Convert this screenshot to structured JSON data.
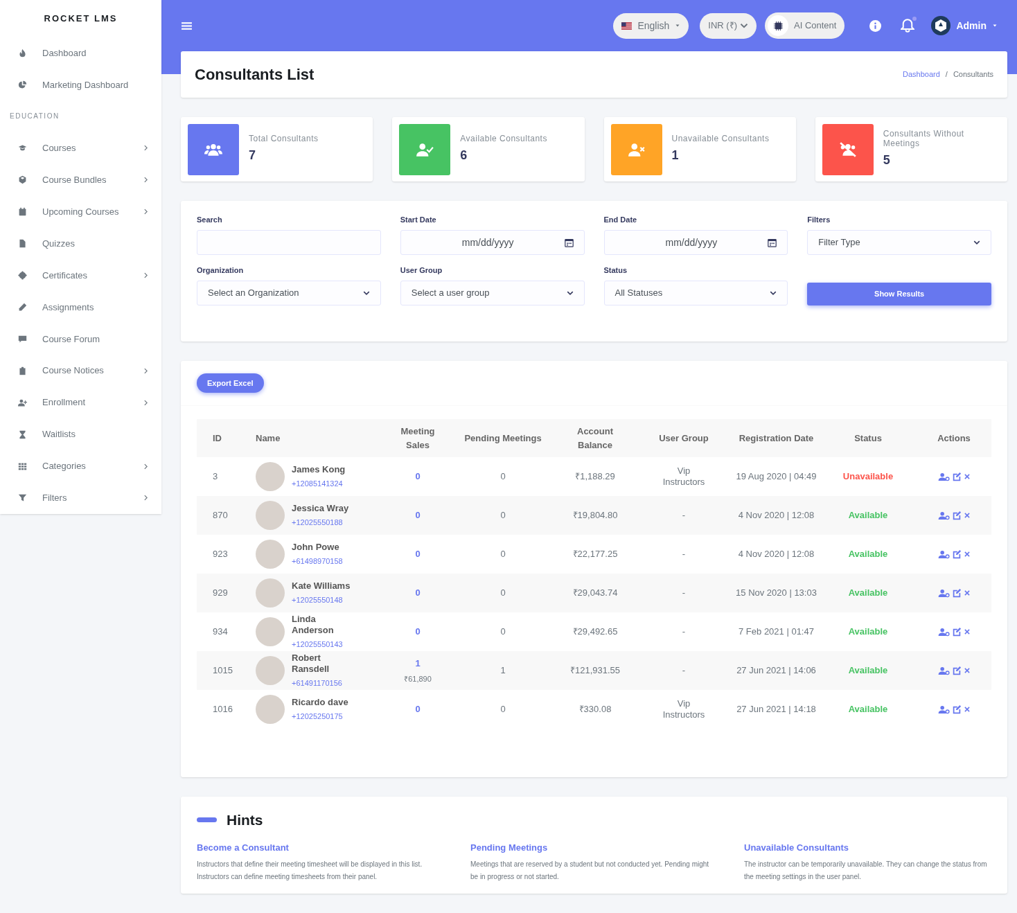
{
  "sidebar": {
    "brand": "ROCKET LMS",
    "items": [
      {
        "kind": "item",
        "label": "Dashboard",
        "has_submenu": false
      },
      {
        "kind": "item",
        "label": "Marketing Dashboard",
        "has_submenu": false
      },
      {
        "kind": "section",
        "label": "EDUCATION"
      },
      {
        "kind": "item",
        "label": "Courses",
        "has_submenu": true
      },
      {
        "kind": "item",
        "label": "Course Bundles",
        "has_submenu": true
      },
      {
        "kind": "item",
        "label": "Upcoming Courses",
        "has_submenu": true
      },
      {
        "kind": "item",
        "label": "Quizzes",
        "has_submenu": false
      },
      {
        "kind": "item",
        "label": "Certificates",
        "has_submenu": true
      },
      {
        "kind": "item",
        "label": "Assignments",
        "has_submenu": false
      },
      {
        "kind": "item",
        "label": "Course Forum",
        "has_submenu": false
      },
      {
        "kind": "item",
        "label": "Course Notices",
        "has_submenu": true
      },
      {
        "kind": "item",
        "label": "Enrollment",
        "has_submenu": true
      },
      {
        "kind": "item",
        "label": "Waitlists",
        "has_submenu": false
      },
      {
        "kind": "item",
        "label": "Categories",
        "has_submenu": true
      },
      {
        "kind": "item",
        "label": "Filters",
        "has_submenu": true
      }
    ]
  },
  "topbar": {
    "language": "English",
    "currency": "INR (₹)",
    "ai_button": "AI Content",
    "notification_dot": true,
    "user": "Admin"
  },
  "page": {
    "title": "Consultants List",
    "breadcrumbs": [
      {
        "label": "Dashboard",
        "link": true
      },
      {
        "label": "Consultants",
        "link": false
      }
    ],
    "breadcrumb_separator": "/"
  },
  "stats": [
    {
      "label": "Total Consultants",
      "value": "7",
      "color": "#6777ef"
    },
    {
      "label": "Available Consultants",
      "value": "6",
      "color": "#47c363"
    },
    {
      "label": "Unavailable Consultants",
      "value": "1",
      "color": "#ffa426"
    },
    {
      "label": "Consultants Without Meetings",
      "value": "5",
      "color": "#fc544b"
    }
  ],
  "filters": [
    {
      "kind": "text",
      "label": "Search"
    },
    {
      "kind": "date",
      "label": "Start Date",
      "placeholder": "mm/dd/yyyy"
    },
    {
      "kind": "date",
      "label": "End Date",
      "placeholder": "mm/dd/yyyy"
    },
    {
      "kind": "select",
      "label": "Filters",
      "value": "Filter Type"
    },
    {
      "kind": "select",
      "label": "Organization",
      "value": "Select an Organization"
    },
    {
      "kind": "select",
      "label": "User Group",
      "value": "Select a user group"
    },
    {
      "kind": "select",
      "label": "Status",
      "value": "All Statuses"
    },
    {
      "kind": "button",
      "label": "Show Results"
    }
  ],
  "export_button": "Export Excel",
  "table": {
    "columns": [
      "ID",
      "Name",
      "Meeting Sales",
      "Pending Meetings",
      "Account Balance",
      "User Group",
      "Registration Date",
      "Status",
      "Actions"
    ],
    "rows": [
      {
        "id": "3",
        "name": "James Kong",
        "phone": "+12085141324",
        "sales": "0",
        "pending": "0",
        "balance": "₹1,188.29",
        "group": "Vip Instructors",
        "date": "19 Aug 2020 | 04:49",
        "status": "Unavailable",
        "available": false
      },
      {
        "id": "870",
        "name": "Jessica Wray",
        "phone": "+12025550188",
        "sales": "0",
        "pending": "0",
        "balance": "₹19,804.80",
        "group": "-",
        "date": "4 Nov 2020 | 12:08",
        "status": "Available",
        "available": true
      },
      {
        "id": "923",
        "name": "John Powe",
        "phone": "+61498970158",
        "sales": "0",
        "pending": "0",
        "balance": "₹22,177.25",
        "group": "-",
        "date": "4 Nov 2020 | 12:08",
        "status": "Available",
        "available": true
      },
      {
        "id": "929",
        "name": "Kate Williams",
        "phone": "+12025550148",
        "sales": "0",
        "pending": "0",
        "balance": "₹29,043.74",
        "group": "-",
        "date": "15 Nov 2020 | 13:03",
        "status": "Available",
        "available": true
      },
      {
        "id": "934",
        "name": "Linda Anderson",
        "phone": "+12025550143",
        "sales": "0",
        "pending": "0",
        "balance": "₹29,492.65",
        "group": "-",
        "date": "7 Feb 2021 | 01:47",
        "status": "Available",
        "available": true
      },
      {
        "id": "1015",
        "name": "Robert Ransdell",
        "phone": "+61491170156",
        "sales": "1",
        "sales_amount": "₹61,890",
        "pending": "1",
        "balance": "₹121,931.55",
        "group": "-",
        "date": "27 Jun 2021 | 14:06",
        "status": "Available",
        "available": true
      },
      {
        "id": "1016",
        "name": "Ricardo dave",
        "phone": "+12025250175",
        "sales": "0",
        "pending": "0",
        "balance": "₹330.08",
        "group": "Vip Instructors",
        "date": "27 Jun 2021 | 14:18",
        "status": "Available",
        "available": true
      }
    ]
  },
  "hints": {
    "title": "Hints",
    "items": [
      {
        "title": "Become a Consultant",
        "text": "Instructors that define their meeting timesheet will be displayed in this list. Instructors can define meeting timesheets from their panel."
      },
      {
        "title": "Pending Meetings",
        "text": "Meetings that are reserved by a student but not conducted yet. Pending might be in progress or not started."
      },
      {
        "title": "Unavailable Consultants",
        "text": "The instructor can be temporarily unavailable. They can change the status from the meeting settings in the user panel."
      }
    ]
  }
}
